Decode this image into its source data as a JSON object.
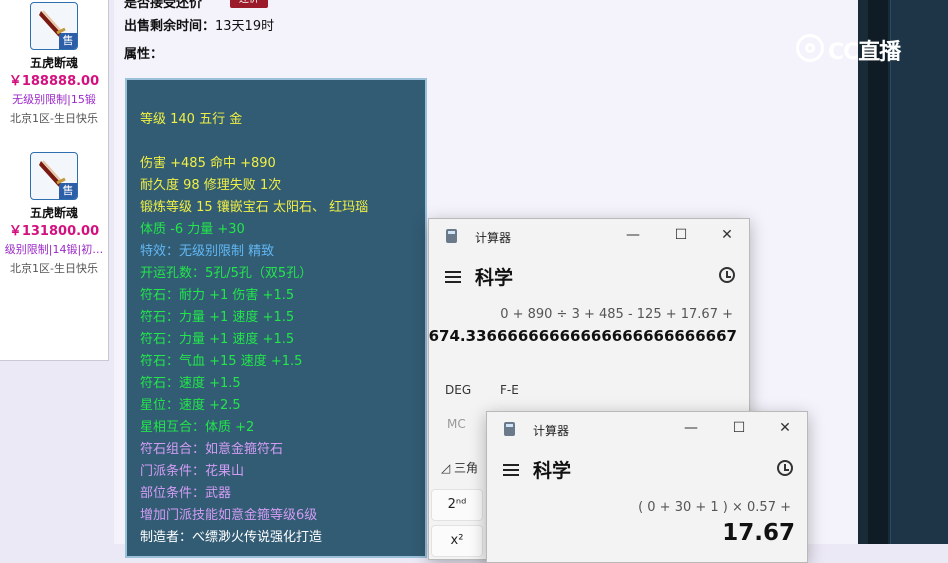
{
  "items": [
    {
      "name": "五虎断魂",
      "price": "￥188888.00",
      "sub": "无级别限制|15锻",
      "server": "北京1区-生日快乐",
      "badge": "售"
    },
    {
      "name": "五虎断魂",
      "price": "￥131800.00",
      "sub": "级别限制|14锻|初…",
      "server": "北京1区-生日快乐",
      "badge": "售"
    }
  ],
  "detail": {
    "top_label": "是否接受还价",
    "top_button": "还价",
    "sale_time_label": "出售剩余时间：",
    "sale_time_value": "13天19时",
    "attr_label": "属性："
  },
  "attributes": [
    {
      "text": "等级 140 五行 金",
      "color": "yellow"
    },
    {
      "text": "伤害 +485 命中 +890",
      "color": "yellow"
    },
    {
      "text": "耐久度 98 修理失败 1次",
      "color": "yellow"
    },
    {
      "text": "锻炼等级 15 镶嵌宝石 太阳石、 红玛瑙",
      "color": "yellow"
    },
    {
      "text": "体质 -6 力量 +30",
      "color": "green"
    },
    {
      "text": "特效：无级别限制 精致",
      "color": "blue"
    },
    {
      "text": "开运孔数：5孔/5孔（双5孔）",
      "color": "green"
    },
    {
      "text": "符石：耐力 +1 伤害 +1.5",
      "color": "green"
    },
    {
      "text": "符石：力量 +1 速度 +1.5",
      "color": "green"
    },
    {
      "text": "符石：力量 +1 速度 +1.5",
      "color": "green"
    },
    {
      "text": "符石：气血 +15 速度 +1.5",
      "color": "green"
    },
    {
      "text": "符石：速度 +1.5",
      "color": "green"
    },
    {
      "text": "星位：速度 +2.5",
      "color": "green"
    },
    {
      "text": "星相互合：体质 +2",
      "color": "green"
    },
    {
      "text": "符石组合：如意金箍符石",
      "color": "purple"
    },
    {
      "text": "门派条件：花果山",
      "color": "purple"
    },
    {
      "text": "部位条件：武器",
      "color": "purple"
    },
    {
      "text": "增加门派技能如意金箍等级6级",
      "color": "purple"
    },
    {
      "text": "制造者：べ缥渺火传说强化打造",
      "color": "white"
    }
  ],
  "logo": {
    "text": "CC直播"
  },
  "calc1": {
    "title": "计算器",
    "mode": "科学",
    "expression": "0 + 890 ÷ 3 + 485 - 125 + 17.67 +",
    "result": "674.33666666666666666666666667",
    "deg_label": "DEG",
    "fe_label": "F-E",
    "mc_label": "MC",
    "trig_label": "三角",
    "btn_2nd": "2ⁿᵈ",
    "btn_x2": "x²"
  },
  "calc2": {
    "title": "计算器",
    "mode": "科学",
    "expression": "( 0 + 30 + 1 ) × 0.57 +",
    "result": "17.67"
  },
  "win_controls": {
    "minimize": "—",
    "maximize": "☐",
    "close": "✕"
  }
}
